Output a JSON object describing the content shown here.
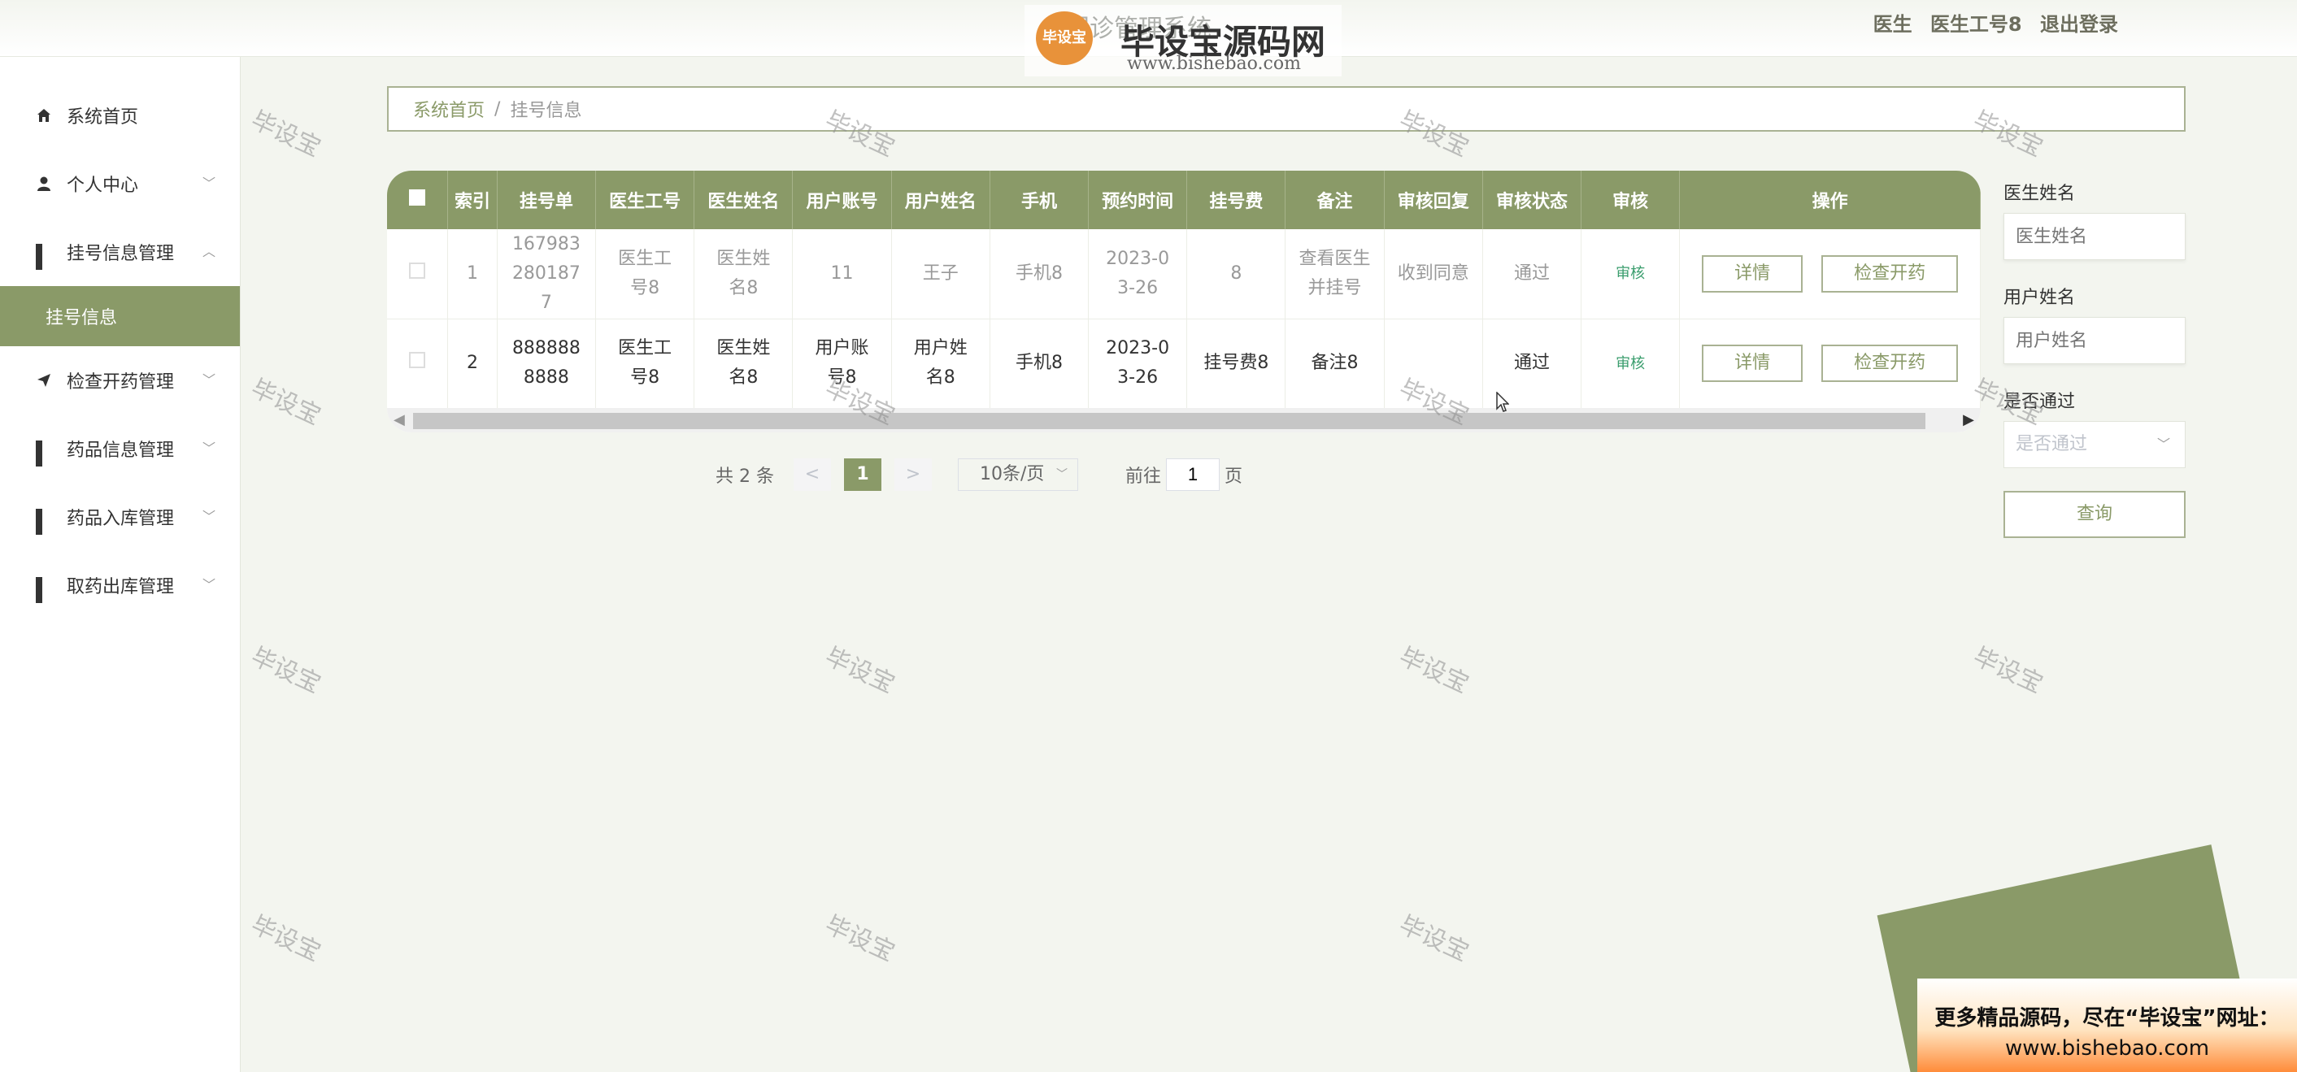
{
  "header": {
    "title": "门诊管理系统",
    "brand": "毕设宝源码网",
    "brand_url": "www.bishebao.com",
    "logo_text": "毕设宝",
    "user_role": "医生",
    "user_name": "医生工号8",
    "logout": "退出登录"
  },
  "sidebar": {
    "items": [
      {
        "label": "系统首页",
        "icon": "home-icon"
      },
      {
        "label": "个人中心",
        "icon": "user-icon"
      },
      {
        "label": "挂号信息管理",
        "icon": "grid-icon"
      },
      {
        "label": "挂号信息",
        "icon": ""
      },
      {
        "label": "检查开药管理",
        "icon": "send-icon"
      },
      {
        "label": "药品信息管理",
        "icon": "grid-icon"
      },
      {
        "label": "药品入库管理",
        "icon": "grid-icon"
      },
      {
        "label": "取药出库管理",
        "icon": "grid-icon"
      }
    ]
  },
  "breadcrumb": {
    "home": "系统首页",
    "sep": "/",
    "current": "挂号信息"
  },
  "table": {
    "headers": [
      "索引",
      "挂号单",
      "医生工号",
      "医生姓名",
      "用户账号",
      "用户姓名",
      "手机",
      "预约时间",
      "挂号费",
      "备注",
      "审核回复",
      "审核状态",
      "审核",
      "操作"
    ],
    "rows": [
      {
        "index": "1",
        "order": "1679832801877",
        "doctor_no": "医生工号8",
        "doctor_name": "医生姓名8",
        "account": "11",
        "user_name": "王子",
        "phone": "手机8",
        "time": "2023-03-26",
        "fee": "8",
        "note": "查看医生并挂号",
        "reply": "收到同意",
        "status": "通过",
        "audit": "审核",
        "detail": "详情",
        "action": "检查开药"
      },
      {
        "index": "2",
        "order": "8888888888",
        "doctor_no": "医生工号8",
        "doctor_name": "医生姓名8",
        "account": "用户账号8",
        "user_name": "用户姓名8",
        "phone": "手机8",
        "time": "2023-03-26",
        "fee": "挂号费8",
        "note": "备注8",
        "reply": "",
        "status": "通过",
        "audit": "审核",
        "detail": "详情",
        "action": "检查开药"
      }
    ]
  },
  "pagination": {
    "total": "共 2 条",
    "prev": "<",
    "current": "1",
    "next": ">",
    "page_size": "10条/页",
    "goto_label": "前往",
    "goto_value": "1",
    "page_suffix": "页"
  },
  "search": {
    "doctor_label": "医生姓名",
    "doctor_placeholder": "医生姓名",
    "user_label": "用户姓名",
    "user_placeholder": "用户姓名",
    "pass_label": "是否通过",
    "pass_placeholder": "是否通过",
    "query_button": "查询"
  },
  "watermark": "毕设宝",
  "ad": {
    "line1": "更多精品源码，尽在“毕设宝”网址：",
    "line2": "www.bishebao.com"
  },
  "colors": {
    "accent": "#8a9a68",
    "link": "#3a9d6d"
  }
}
